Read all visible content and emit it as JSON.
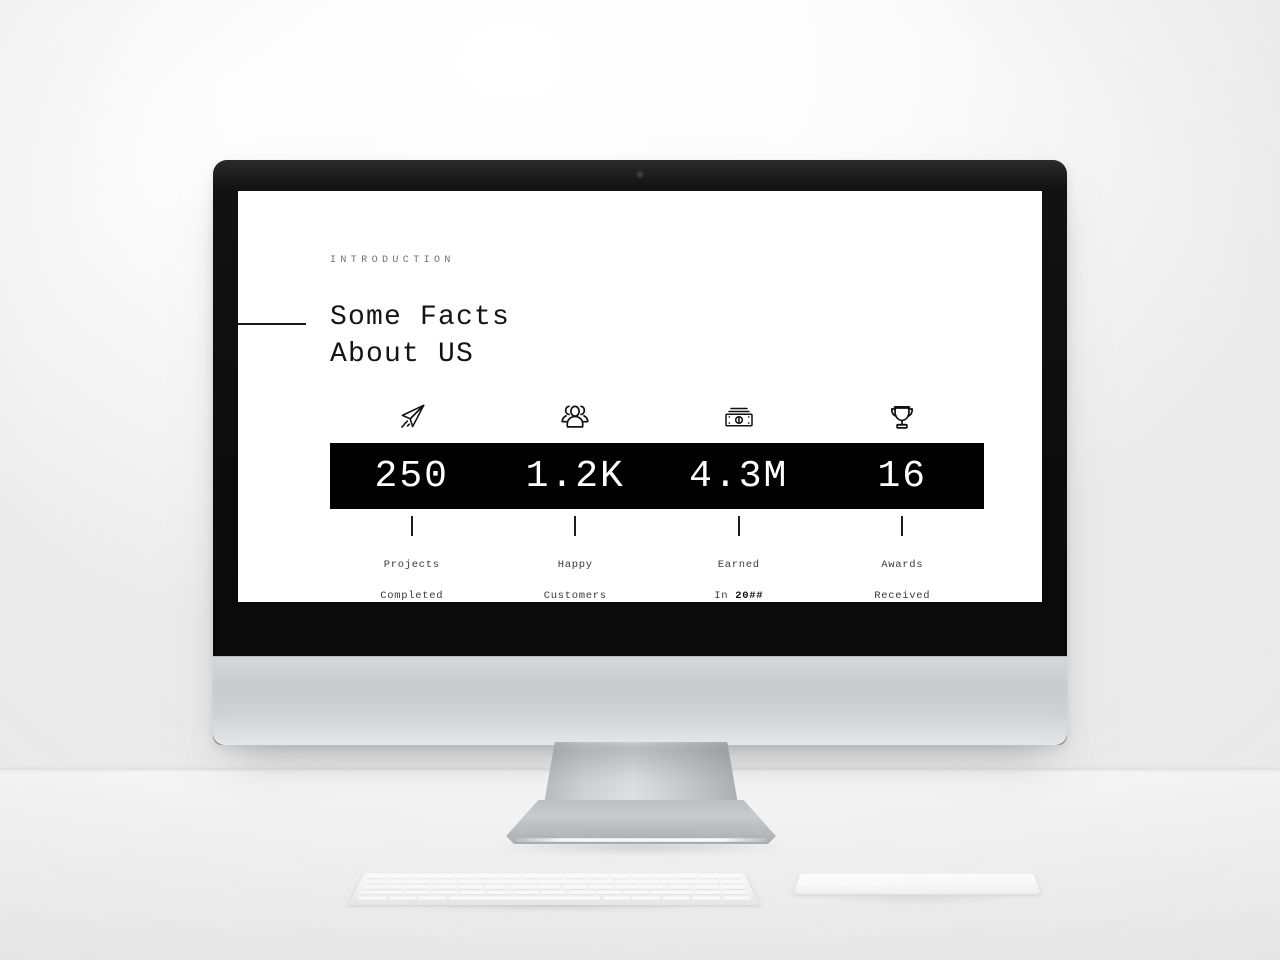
{
  "scene": {
    "device": "imac-desktop-computer",
    "peripherals": [
      "keyboard",
      "trackpad"
    ]
  },
  "slide": {
    "eyebrow": "INTRODUCTION",
    "headline": "Some Facts\nAbout US",
    "accent_color": "#000000",
    "bar_background": "#000000",
    "bar_text_color": "#ffffff"
  },
  "stats": [
    {
      "icon": "paper-plane-icon",
      "value": "250",
      "label_line1": "Projects",
      "label_line2": "Completed"
    },
    {
      "icon": "users-group-icon",
      "value": "1.2K",
      "label_line1": "Happy",
      "label_line2": "Customers"
    },
    {
      "icon": "money-banknotes-icon",
      "value": "4.3M",
      "label_line1": "Earned",
      "label_line2_prefix": "In ",
      "label_line2_strong": "20##"
    },
    {
      "icon": "trophy-icon",
      "value": "16",
      "label_line1": "Awards",
      "label_line2": "Received"
    }
  ],
  "chart_data": {
    "type": "bar",
    "title": "Some Facts About US",
    "categories": [
      "Projects Completed",
      "Happy Customers",
      "Earned In 20##",
      "Awards Received"
    ],
    "values": [
      "250",
      "1.2K",
      "4.3M",
      "16"
    ],
    "numeric_values": [
      250,
      1200,
      4300000,
      16
    ],
    "xlabel": "",
    "ylabel": "",
    "legend": []
  }
}
